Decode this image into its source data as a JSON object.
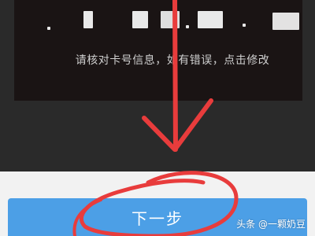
{
  "card_info": {
    "hint": "请核对卡号信息，如有错误，点击修改"
  },
  "actions": {
    "next_label": "下一步"
  },
  "watermark": {
    "text": "头条 @一颗奶豆"
  },
  "colors": {
    "card_panel": "#1a1414",
    "backdrop": "#2a2a2a",
    "button": "#4c9fe6",
    "annotation": "#e83c3c"
  },
  "icons": {
    "annotation_arrow": "down-arrow-icon"
  }
}
